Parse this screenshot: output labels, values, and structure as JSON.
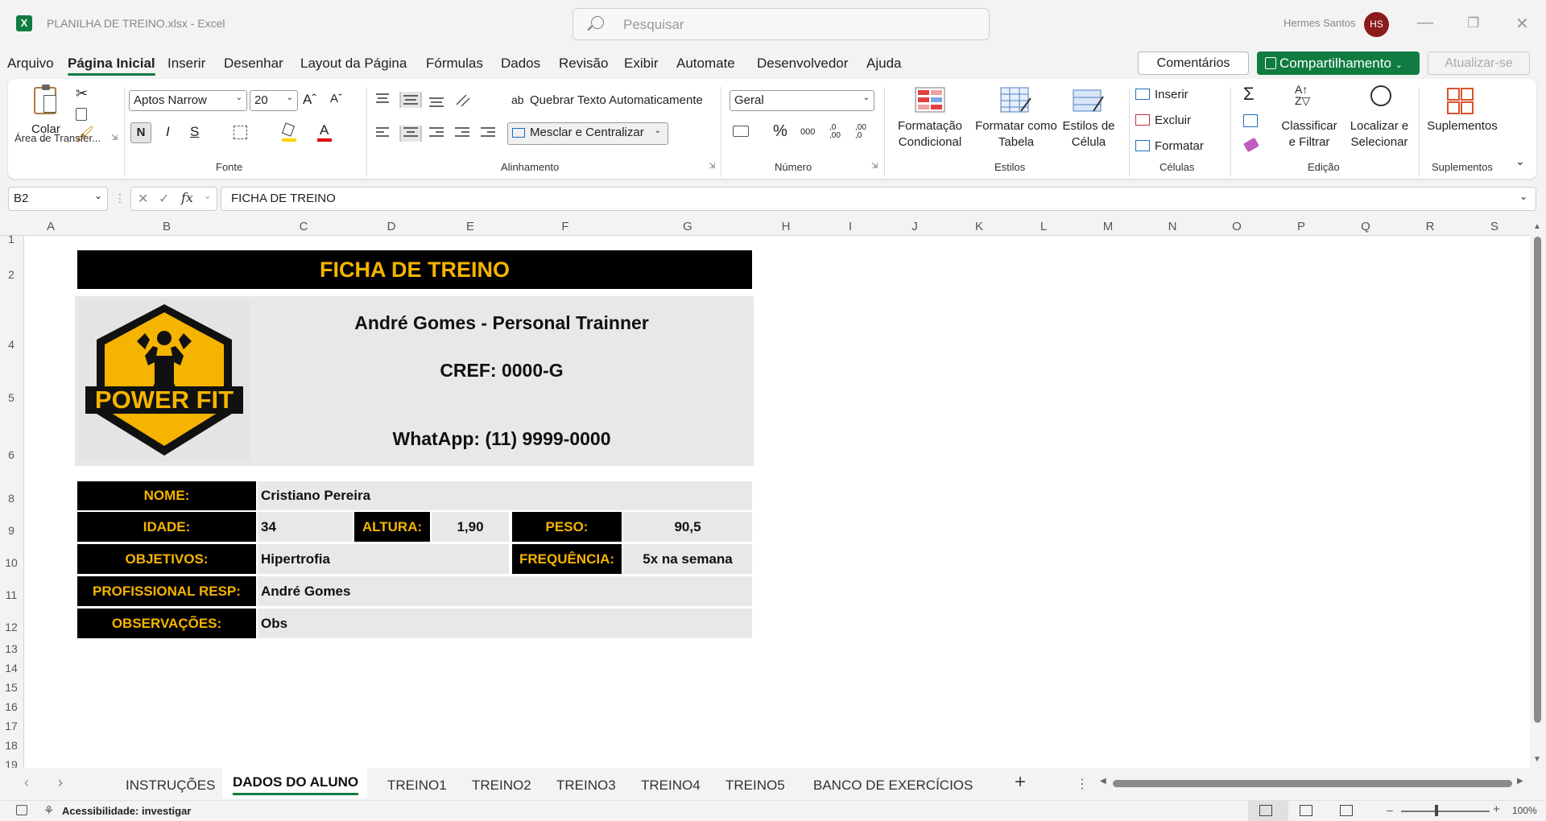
{
  "window": {
    "title": "PLANILHA DE TREINO.xlsx  -  Excel",
    "search_placeholder": "Pesquisar",
    "user_name": "Hermes Santos",
    "user_initials": "HS"
  },
  "menu": [
    "Arquivo",
    "Página Inicial",
    "Inserir",
    "Desenhar",
    "Layout da Página",
    "Fórmulas",
    "Dados",
    "Revisão",
    "Exibir",
    "Automate",
    "Desenvolvedor",
    "Ajuda"
  ],
  "menu_active": "Página Inicial",
  "actions": {
    "comments": "Comentários",
    "share": "Compartilhamento",
    "update": "Atualizar-se"
  },
  "ribbon": {
    "clipboard": {
      "paste": "Colar",
      "group": "Área de Transfer..."
    },
    "font": {
      "family": "Aptos Narrow",
      "size": "20",
      "group": "Fonte",
      "bold": "N",
      "italic": "I",
      "underline": "S"
    },
    "alignment": {
      "wrap": "Quebrar Texto Automaticamente",
      "merge": "Mesclar e Centralizar",
      "group": "Alinhamento"
    },
    "number": {
      "format": "Geral",
      "group": "Número",
      "percent": "%",
      "thousands": "000",
      "dec_inc": ",0 ,00",
      "dec_dec": ",00 ,0"
    },
    "styles": {
      "conditional_1": "Formatação",
      "conditional_2": "Condicional",
      "table_1": "Formatar como",
      "table_2": "Tabela",
      "cell_1": "Estilos de",
      "cell_2": "Célula",
      "group": "Estilos"
    },
    "cells": {
      "insert": "Inserir",
      "delete": "Excluir",
      "format": "Formatar",
      "group": "Células"
    },
    "editing": {
      "sort_1": "Classificar",
      "sort_2": "e Filtrar",
      "find_1": "Localizar e",
      "find_2": "Selecionar",
      "group": "Edição"
    },
    "addins": {
      "label": "Suplementos",
      "group": "Suplementos"
    }
  },
  "formula_bar": {
    "name_box": "B2",
    "fx": "fx",
    "content": "FICHA DE TREINO"
  },
  "columns": [
    "A",
    "B",
    "C",
    "D",
    "E",
    "F",
    "G",
    "H",
    "I",
    "J",
    "K",
    "L",
    "M",
    "N",
    "O",
    "P",
    "Q",
    "R",
    "S"
  ],
  "rows": [
    "1",
    "2",
    "4",
    "5",
    "6",
    "8",
    "9",
    "10",
    "11",
    "12",
    "13",
    "14",
    "15",
    "16",
    "17",
    "18",
    "19"
  ],
  "sheet": {
    "header": "FICHA DE TREINO",
    "logo_text": "POWER FIT",
    "trainer": "André Gomes - Personal Trainner",
    "cref": "CREF: 0000-G",
    "whatsapp": "WhatApp: (11) 9999-0000",
    "labels": {
      "nome": "NOME:",
      "idade": "IDADE:",
      "altura": "ALTURA:",
      "peso": "PESO:",
      "objetivos": "OBJETIVOS:",
      "frequencia": "FREQUÊNCIA:",
      "profissional": "PROFISSIONAL RESP:",
      "observacoes": "OBSERVAÇÕES:"
    },
    "values": {
      "nome": "Cristiano Pereira",
      "idade": "34",
      "altura": "1,90",
      "peso": "90,5",
      "objetivos": "Hipertrofia",
      "frequencia": "5x na semana",
      "profissional": "André Gomes",
      "observacoes": "Obs"
    }
  },
  "tabs": [
    "INSTRUÇÕES",
    "DADOS DO ALUNO",
    "TREINO1",
    "TREINO2",
    "TREINO3",
    "TREINO4",
    "TREINO5",
    "BANCO DE EXERCÍCIOS"
  ],
  "tab_active": "DADOS DO ALUNO",
  "status": {
    "accessibility": "Acessibilidade: investigar",
    "zoom": "100%"
  },
  "colors": {
    "accent": "#107c41",
    "header_bg": "#000000",
    "header_text": "#f5b400",
    "panel": "#e8e8e8"
  }
}
